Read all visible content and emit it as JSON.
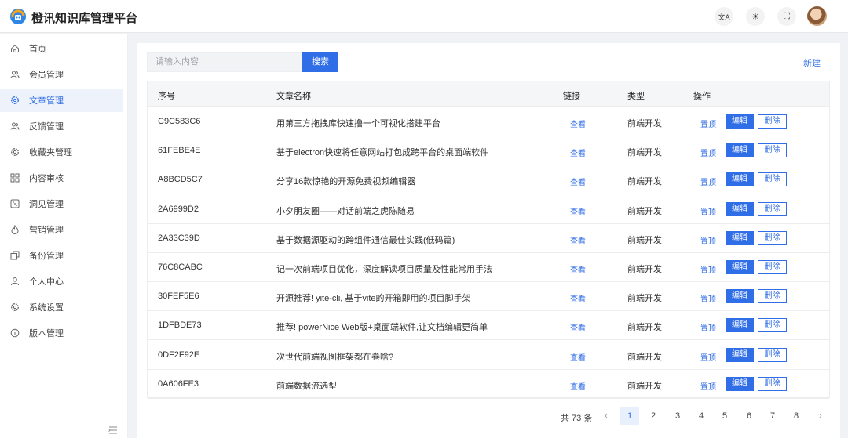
{
  "app": {
    "title": "橙讯知识库管理平台"
  },
  "header": {
    "buttons": [
      {
        "icon": "translate-icon",
        "glyph": "文A"
      },
      {
        "icon": "theme-icon",
        "glyph": "☀"
      },
      {
        "icon": "fullscreen-icon",
        "glyph": "⛶"
      }
    ]
  },
  "sidebar": {
    "items": [
      {
        "label": "首页",
        "icon": "home-icon"
      },
      {
        "label": "会员管理",
        "icon": "users-icon"
      },
      {
        "label": "文章管理",
        "icon": "gear-icon",
        "active": true
      },
      {
        "label": "反馈管理",
        "icon": "users-icon"
      },
      {
        "label": "收藏夹管理",
        "icon": "gear-icon"
      },
      {
        "label": "内容审核",
        "icon": "grid-icon"
      },
      {
        "label": "洞见管理",
        "icon": "dice-icon"
      },
      {
        "label": "营销管理",
        "icon": "fire-icon"
      },
      {
        "label": "备份管理",
        "icon": "backup-icon"
      },
      {
        "label": "个人中心",
        "icon": "user-icon"
      },
      {
        "label": "系统设置",
        "icon": "gear-icon"
      },
      {
        "label": "版本管理",
        "icon": "info-icon"
      }
    ]
  },
  "search": {
    "placeholder": "请输入内容",
    "button_label": "搜索"
  },
  "toolbar": {
    "new_label": "新建"
  },
  "table": {
    "headers": [
      "序号",
      "文章名称",
      "链接",
      "类型",
      "操作"
    ],
    "rows": [
      {
        "id": "C9C583C6",
        "title": "用第三方拖拽库快速撸一个可视化搭建平台",
        "link": "查看",
        "type": "前端开发"
      },
      {
        "id": "61FEBE4E",
        "title": "基于electron快速将任意网站打包成跨平台的桌面端软件",
        "link": "查看",
        "type": "前端开发"
      },
      {
        "id": "A8BCD5C7",
        "title": "分享16款惊艳的开源免费视频编辑器",
        "link": "查看",
        "type": "前端开发"
      },
      {
        "id": "2A6999D2",
        "title": "小夕朋友圈——对话前端之虎陈随易",
        "link": "查看",
        "type": "前端开发"
      },
      {
        "id": "2A33C39D",
        "title": "基于数据源驱动的跨组件通信最佳实践(低码篇)",
        "link": "查看",
        "type": "前端开发"
      },
      {
        "id": "76C8CABC",
        "title": "记一次前端项目优化，深度解读项目质量及性能常用手法",
        "link": "查看",
        "type": "前端开发"
      },
      {
        "id": "30FEF5E6",
        "title": "开源推荐! yite-cli, 基于vite的开箱即用的项目脚手架",
        "link": "查看",
        "type": "前端开发"
      },
      {
        "id": "1DFBDE73",
        "title": "推荐! powerNice Web版+桌面端软件,让文档编辑更简单",
        "link": "查看",
        "type": "前端开发"
      },
      {
        "id": "0DF2F92E",
        "title": "次世代前端视图框架都在卷啥?",
        "link": "查看",
        "type": "前端开发"
      },
      {
        "id": "0A606FE3",
        "title": "前端数据流选型",
        "link": "查看",
        "type": "前端开发"
      }
    ],
    "actions": {
      "top": "置顶",
      "edit": "编辑",
      "delete": "删除"
    }
  },
  "pagination": {
    "total": "共 73 条",
    "pages": [
      "1",
      "2",
      "3",
      "4",
      "5",
      "6",
      "7",
      "8"
    ],
    "current": "1",
    "prev": "‹",
    "next": "›"
  },
  "colors": {
    "accent": "#2f6ee6"
  }
}
